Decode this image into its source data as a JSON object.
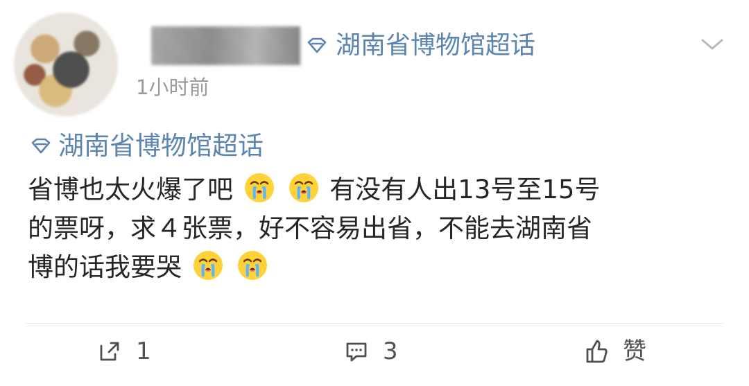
{
  "header": {
    "supertopic": "湖南省博物馆超话",
    "timestamp": "1小时前"
  },
  "post": {
    "topic": "湖南省博物馆超话",
    "line1_part1": "省博也太火爆了吧",
    "line1_part2": "有没有人出13号至15号",
    "line2": "的票呀，求４张票，好不容易出省，不能去湖南省",
    "line3": "博的话我要哭",
    "emoji": "crying-face-emoji"
  },
  "actions": {
    "repost_count": "1",
    "comment_count": "3",
    "like_label": "赞"
  },
  "colors": {
    "topic_blue": "#5b84b1",
    "text": "#262626",
    "meta_gray": "#9a9a9a",
    "action_gray": "#505050"
  }
}
